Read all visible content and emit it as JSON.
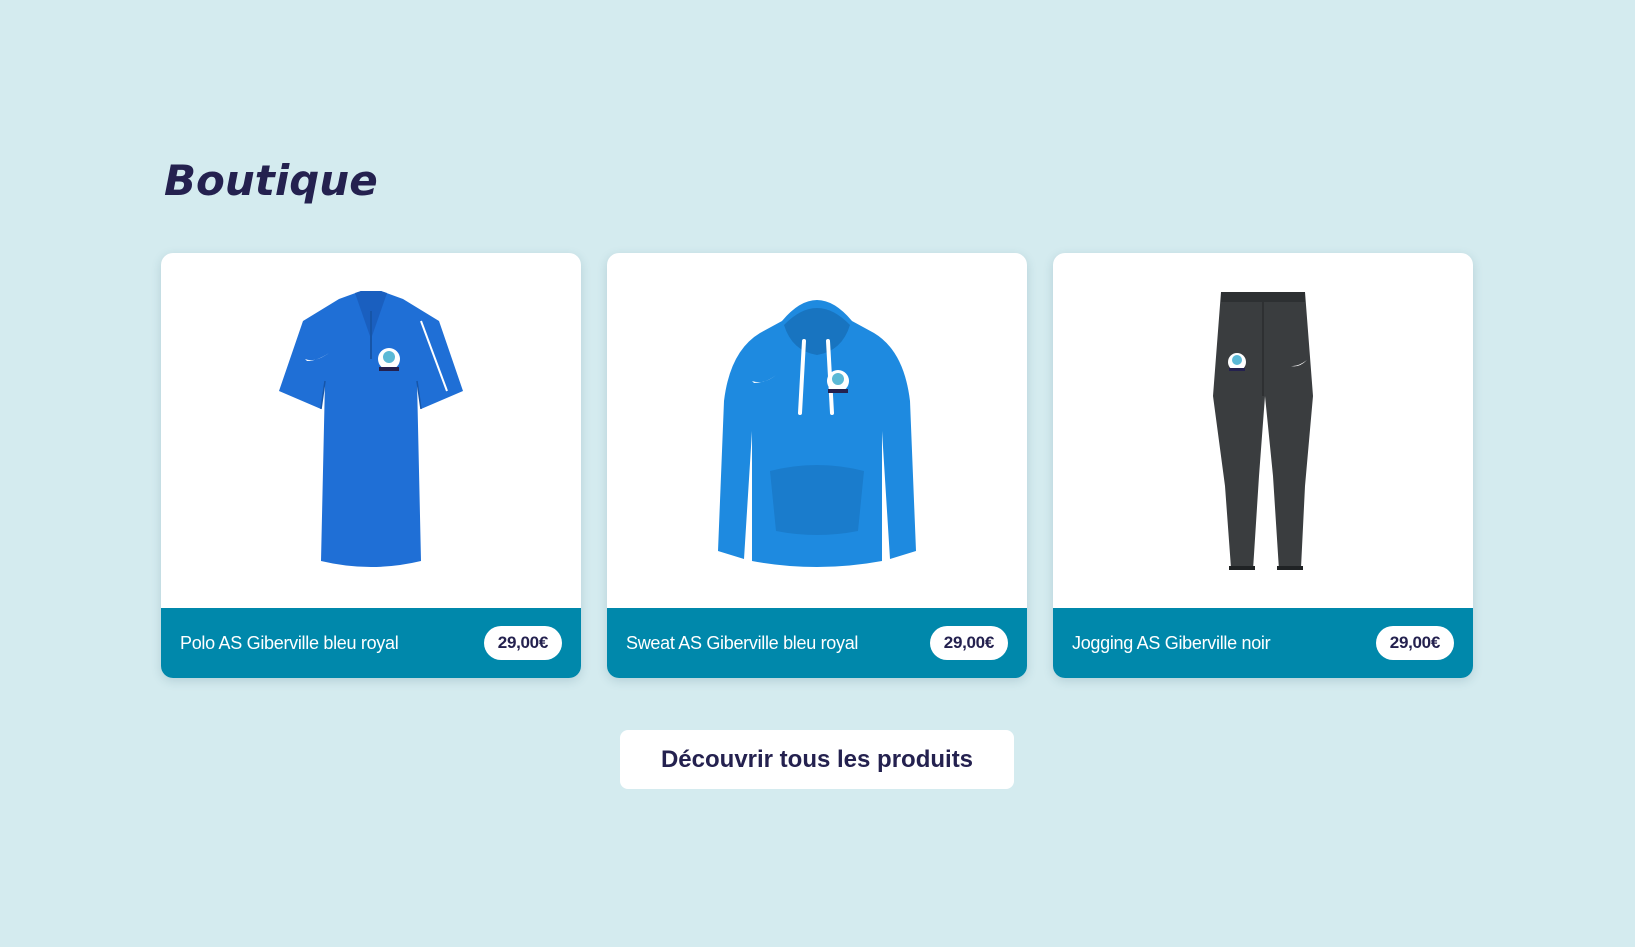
{
  "page": {
    "title": "Boutique"
  },
  "products": [
    {
      "name": "Polo AS Giberville bleu royal",
      "price": "29,00€",
      "image_icon": "polo-shirt-icon",
      "color": "#1f6fd6"
    },
    {
      "name": "Sweat AS Giberville bleu royal",
      "price": "29,00€",
      "image_icon": "hoodie-icon",
      "color": "#1e8ae0"
    },
    {
      "name": "Jogging AS Giberville noir",
      "price": "29,00€",
      "image_icon": "jogging-pants-icon",
      "color": "#3a3d3f"
    }
  ],
  "cta": {
    "label": "Découvrir tous les produits"
  },
  "theme": {
    "background": "#d4ebef",
    "accent": "#0088ab",
    "title_color": "#24214f"
  }
}
